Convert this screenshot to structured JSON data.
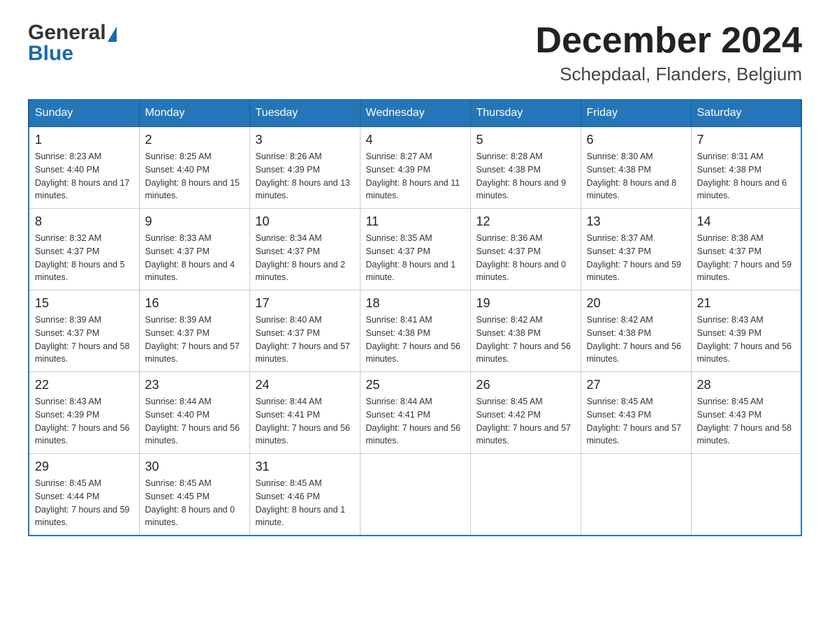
{
  "header": {
    "logo_general": "General",
    "logo_blue": "Blue",
    "title": "December 2024",
    "subtitle": "Schepdaal, Flanders, Belgium"
  },
  "columns": [
    "Sunday",
    "Monday",
    "Tuesday",
    "Wednesday",
    "Thursday",
    "Friday",
    "Saturday"
  ],
  "weeks": [
    [
      {
        "day": "1",
        "sunrise": "Sunrise: 8:23 AM",
        "sunset": "Sunset: 4:40 PM",
        "daylight": "Daylight: 8 hours and 17 minutes."
      },
      {
        "day": "2",
        "sunrise": "Sunrise: 8:25 AM",
        "sunset": "Sunset: 4:40 PM",
        "daylight": "Daylight: 8 hours and 15 minutes."
      },
      {
        "day": "3",
        "sunrise": "Sunrise: 8:26 AM",
        "sunset": "Sunset: 4:39 PM",
        "daylight": "Daylight: 8 hours and 13 minutes."
      },
      {
        "day": "4",
        "sunrise": "Sunrise: 8:27 AM",
        "sunset": "Sunset: 4:39 PM",
        "daylight": "Daylight: 8 hours and 11 minutes."
      },
      {
        "day": "5",
        "sunrise": "Sunrise: 8:28 AM",
        "sunset": "Sunset: 4:38 PM",
        "daylight": "Daylight: 8 hours and 9 minutes."
      },
      {
        "day": "6",
        "sunrise": "Sunrise: 8:30 AM",
        "sunset": "Sunset: 4:38 PM",
        "daylight": "Daylight: 8 hours and 8 minutes."
      },
      {
        "day": "7",
        "sunrise": "Sunrise: 8:31 AM",
        "sunset": "Sunset: 4:38 PM",
        "daylight": "Daylight: 8 hours and 6 minutes."
      }
    ],
    [
      {
        "day": "8",
        "sunrise": "Sunrise: 8:32 AM",
        "sunset": "Sunset: 4:37 PM",
        "daylight": "Daylight: 8 hours and 5 minutes."
      },
      {
        "day": "9",
        "sunrise": "Sunrise: 8:33 AM",
        "sunset": "Sunset: 4:37 PM",
        "daylight": "Daylight: 8 hours and 4 minutes."
      },
      {
        "day": "10",
        "sunrise": "Sunrise: 8:34 AM",
        "sunset": "Sunset: 4:37 PM",
        "daylight": "Daylight: 8 hours and 2 minutes."
      },
      {
        "day": "11",
        "sunrise": "Sunrise: 8:35 AM",
        "sunset": "Sunset: 4:37 PM",
        "daylight": "Daylight: 8 hours and 1 minute."
      },
      {
        "day": "12",
        "sunrise": "Sunrise: 8:36 AM",
        "sunset": "Sunset: 4:37 PM",
        "daylight": "Daylight: 8 hours and 0 minutes."
      },
      {
        "day": "13",
        "sunrise": "Sunrise: 8:37 AM",
        "sunset": "Sunset: 4:37 PM",
        "daylight": "Daylight: 7 hours and 59 minutes."
      },
      {
        "day": "14",
        "sunrise": "Sunrise: 8:38 AM",
        "sunset": "Sunset: 4:37 PM",
        "daylight": "Daylight: 7 hours and 59 minutes."
      }
    ],
    [
      {
        "day": "15",
        "sunrise": "Sunrise: 8:39 AM",
        "sunset": "Sunset: 4:37 PM",
        "daylight": "Daylight: 7 hours and 58 minutes."
      },
      {
        "day": "16",
        "sunrise": "Sunrise: 8:39 AM",
        "sunset": "Sunset: 4:37 PM",
        "daylight": "Daylight: 7 hours and 57 minutes."
      },
      {
        "day": "17",
        "sunrise": "Sunrise: 8:40 AM",
        "sunset": "Sunset: 4:37 PM",
        "daylight": "Daylight: 7 hours and 57 minutes."
      },
      {
        "day": "18",
        "sunrise": "Sunrise: 8:41 AM",
        "sunset": "Sunset: 4:38 PM",
        "daylight": "Daylight: 7 hours and 56 minutes."
      },
      {
        "day": "19",
        "sunrise": "Sunrise: 8:42 AM",
        "sunset": "Sunset: 4:38 PM",
        "daylight": "Daylight: 7 hours and 56 minutes."
      },
      {
        "day": "20",
        "sunrise": "Sunrise: 8:42 AM",
        "sunset": "Sunset: 4:38 PM",
        "daylight": "Daylight: 7 hours and 56 minutes."
      },
      {
        "day": "21",
        "sunrise": "Sunrise: 8:43 AM",
        "sunset": "Sunset: 4:39 PM",
        "daylight": "Daylight: 7 hours and 56 minutes."
      }
    ],
    [
      {
        "day": "22",
        "sunrise": "Sunrise: 8:43 AM",
        "sunset": "Sunset: 4:39 PM",
        "daylight": "Daylight: 7 hours and 56 minutes."
      },
      {
        "day": "23",
        "sunrise": "Sunrise: 8:44 AM",
        "sunset": "Sunset: 4:40 PM",
        "daylight": "Daylight: 7 hours and 56 minutes."
      },
      {
        "day": "24",
        "sunrise": "Sunrise: 8:44 AM",
        "sunset": "Sunset: 4:41 PM",
        "daylight": "Daylight: 7 hours and 56 minutes."
      },
      {
        "day": "25",
        "sunrise": "Sunrise: 8:44 AM",
        "sunset": "Sunset: 4:41 PM",
        "daylight": "Daylight: 7 hours and 56 minutes."
      },
      {
        "day": "26",
        "sunrise": "Sunrise: 8:45 AM",
        "sunset": "Sunset: 4:42 PM",
        "daylight": "Daylight: 7 hours and 57 minutes."
      },
      {
        "day": "27",
        "sunrise": "Sunrise: 8:45 AM",
        "sunset": "Sunset: 4:43 PM",
        "daylight": "Daylight: 7 hours and 57 minutes."
      },
      {
        "day": "28",
        "sunrise": "Sunrise: 8:45 AM",
        "sunset": "Sunset: 4:43 PM",
        "daylight": "Daylight: 7 hours and 58 minutes."
      }
    ],
    [
      {
        "day": "29",
        "sunrise": "Sunrise: 8:45 AM",
        "sunset": "Sunset: 4:44 PM",
        "daylight": "Daylight: 7 hours and 59 minutes."
      },
      {
        "day": "30",
        "sunrise": "Sunrise: 8:45 AM",
        "sunset": "Sunset: 4:45 PM",
        "daylight": "Daylight: 8 hours and 0 minutes."
      },
      {
        "day": "31",
        "sunrise": "Sunrise: 8:45 AM",
        "sunset": "Sunset: 4:46 PM",
        "daylight": "Daylight: 8 hours and 1 minute."
      },
      null,
      null,
      null,
      null
    ]
  ]
}
